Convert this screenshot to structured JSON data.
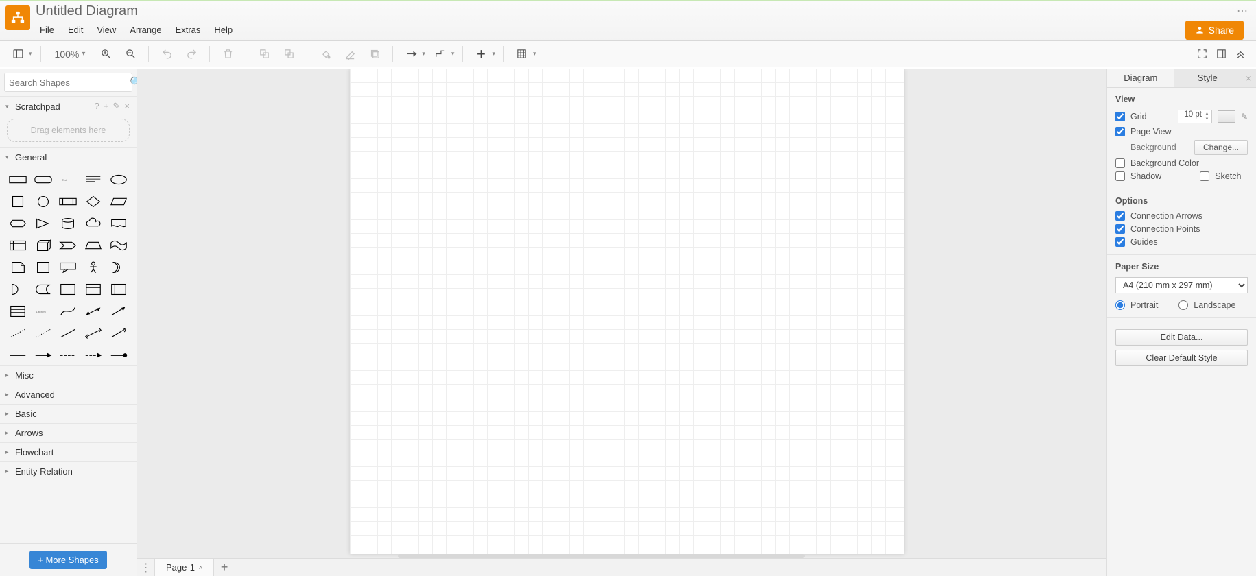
{
  "app": {
    "title": "Untitled Diagram",
    "menus": [
      "File",
      "Edit",
      "View",
      "Arrange",
      "Extras",
      "Help"
    ],
    "share": "Share"
  },
  "toolbar": {
    "zoom": "100%"
  },
  "sidebar": {
    "search_placeholder": "Search Shapes",
    "scratchpad_label": "Scratchpad",
    "scratchpad_hint": "Drag elements here",
    "general_label": "General",
    "more_shapes": "+ More Shapes",
    "categories": [
      "Misc",
      "Advanced",
      "Basic",
      "Arrows",
      "Flowchart",
      "Entity Relation"
    ]
  },
  "pages": {
    "tab1": "Page-1"
  },
  "format": {
    "tabs": {
      "diagram": "Diagram",
      "style": "Style"
    },
    "view": {
      "heading": "View",
      "grid": "Grid",
      "grid_size": "10 pt",
      "pageview": "Page View",
      "background": "Background",
      "change": "Change...",
      "bgcolor": "Background Color",
      "shadow": "Shadow",
      "sketch": "Sketch"
    },
    "options": {
      "heading": "Options",
      "connarrows": "Connection Arrows",
      "connpoints": "Connection Points",
      "guides": "Guides"
    },
    "paper": {
      "heading": "Paper Size",
      "selected": "A4 (210 mm x 297 mm)",
      "portrait": "Portrait",
      "landscape": "Landscape"
    },
    "buttons": {
      "editdata": "Edit Data...",
      "cleardef": "Clear Default Style"
    }
  }
}
